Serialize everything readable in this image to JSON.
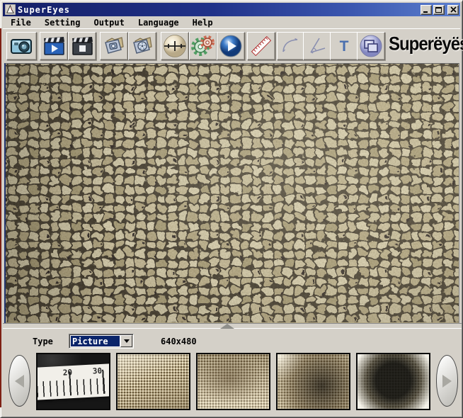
{
  "window": {
    "title": "SuperEyes"
  },
  "menu": {
    "items": [
      "File",
      "Setting",
      "Output",
      "Language",
      "Help"
    ]
  },
  "toolbar": {
    "logo": "Superëyës",
    "text_tool_glyph": "T",
    "buttons": [
      "snapshot-camera",
      "record-video",
      "stop-video",
      "open-photo-folder",
      "open-video-folder",
      "calibration-crosshair",
      "settings-gears",
      "play-preview",
      "ruler-measure",
      "arc-measure",
      "angle-measure",
      "text-annotation",
      "layers-compare"
    ]
  },
  "statusbar": {
    "type_label": "Type",
    "type_value": "Picture",
    "resolution": "640x480"
  },
  "thumbnails": {
    "ruler_labels": [
      "20",
      "30"
    ],
    "items": [
      "ruler-calibration-photo",
      "fabric-mesh-light",
      "fabric-mesh-tan",
      "fabric-mesh-dark",
      "fabric-mesh-darkest"
    ]
  },
  "colors": {
    "chrome": "#d4d0c8",
    "titlebar_start": "#141f66",
    "titlebar_end": "#5c7fce",
    "selection": "#0a246a",
    "fabric_light": "#d8cfae",
    "fabric_dark": "#3f372a"
  }
}
